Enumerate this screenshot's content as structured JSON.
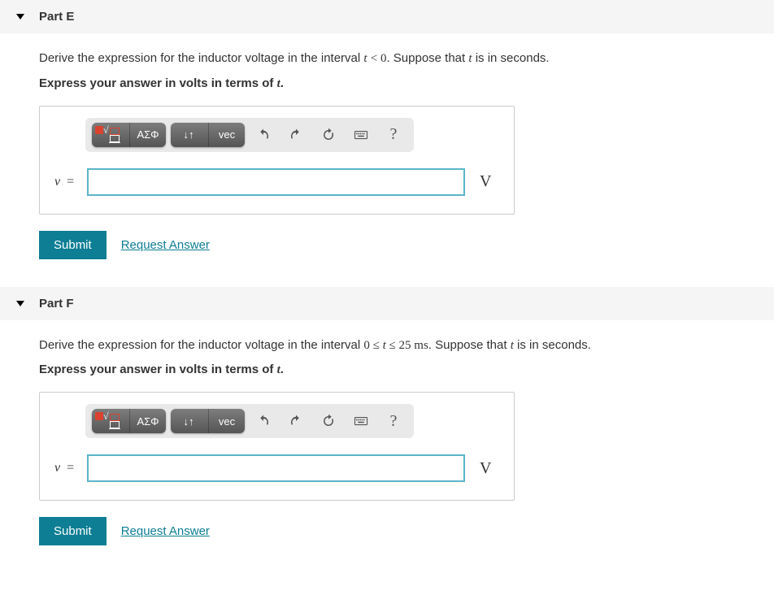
{
  "parts": [
    {
      "title": "Part E",
      "prompt_pre": "Derive the expression for the inductor voltage in the interval ",
      "prompt_math": "t < 0",
      "prompt_post": ". Suppose that ",
      "prompt_var": "t",
      "prompt_end": " is in seconds.",
      "hint_pre": "Express your answer in volts in terms of ",
      "hint_var": "t",
      "hint_post": ".",
      "lhs": "v",
      "eq": " =",
      "unit": "V"
    },
    {
      "title": "Part F",
      "prompt_pre": "Derive the expression for the inductor voltage in the interval ",
      "prompt_math": "0 ≤ t ≤ 25 ms",
      "prompt_post": ". Suppose that ",
      "prompt_var": "t",
      "prompt_end": " is in seconds.",
      "hint_pre": "Express your answer in volts in terms of ",
      "hint_var": "t",
      "hint_post": ".",
      "lhs": "v",
      "eq": " =",
      "unit": "V"
    }
  ],
  "toolbar": {
    "templates": "templates",
    "greek": "ΑΣΦ",
    "scripts": "↓↑",
    "vec": "vec",
    "undo": "undo",
    "redo": "redo",
    "reset": "reset",
    "keyboard": "keyboard",
    "help": "?"
  },
  "actions": {
    "submit": "Submit",
    "request": "Request Answer"
  }
}
